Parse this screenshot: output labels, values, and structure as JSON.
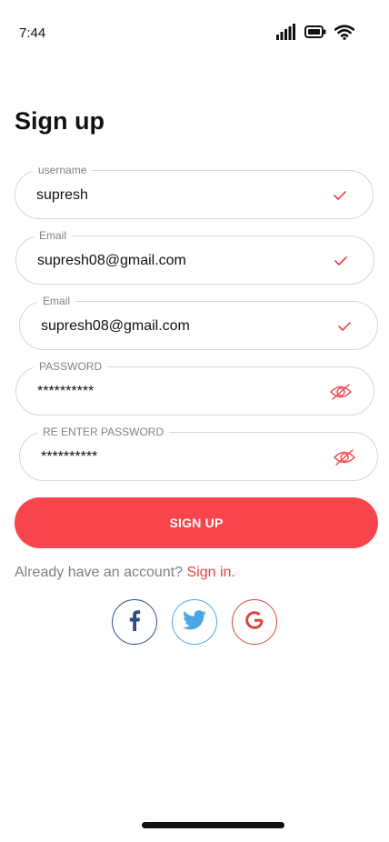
{
  "status_bar": {
    "time": "7:44"
  },
  "page": {
    "title": "Sign up"
  },
  "form": {
    "fields": [
      {
        "label": "username",
        "value": "supresh",
        "icon": "check-icon"
      },
      {
        "label": "Email",
        "value": "supresh08@gmail.com",
        "icon": "check-icon"
      },
      {
        "label": "Email",
        "value": "supresh08@gmail.com",
        "icon": "check-icon"
      },
      {
        "label": "PASSWORD",
        "value": "**********",
        "icon": "eye-off-icon"
      },
      {
        "label": "RE ENTER PASSWORD",
        "value": "**********",
        "icon": "eye-off-icon"
      }
    ],
    "submit_label": "SIGN UP"
  },
  "footer": {
    "prompt": "Already have an account?",
    "link": "Sign in."
  },
  "social": {
    "buttons": [
      "facebook-icon",
      "twitter-icon",
      "google-icon"
    ]
  },
  "colors": {
    "accent": "#f7444d",
    "facebook": "#2f4a86",
    "twitter": "#4aa6e4",
    "google": "#d9473b"
  }
}
